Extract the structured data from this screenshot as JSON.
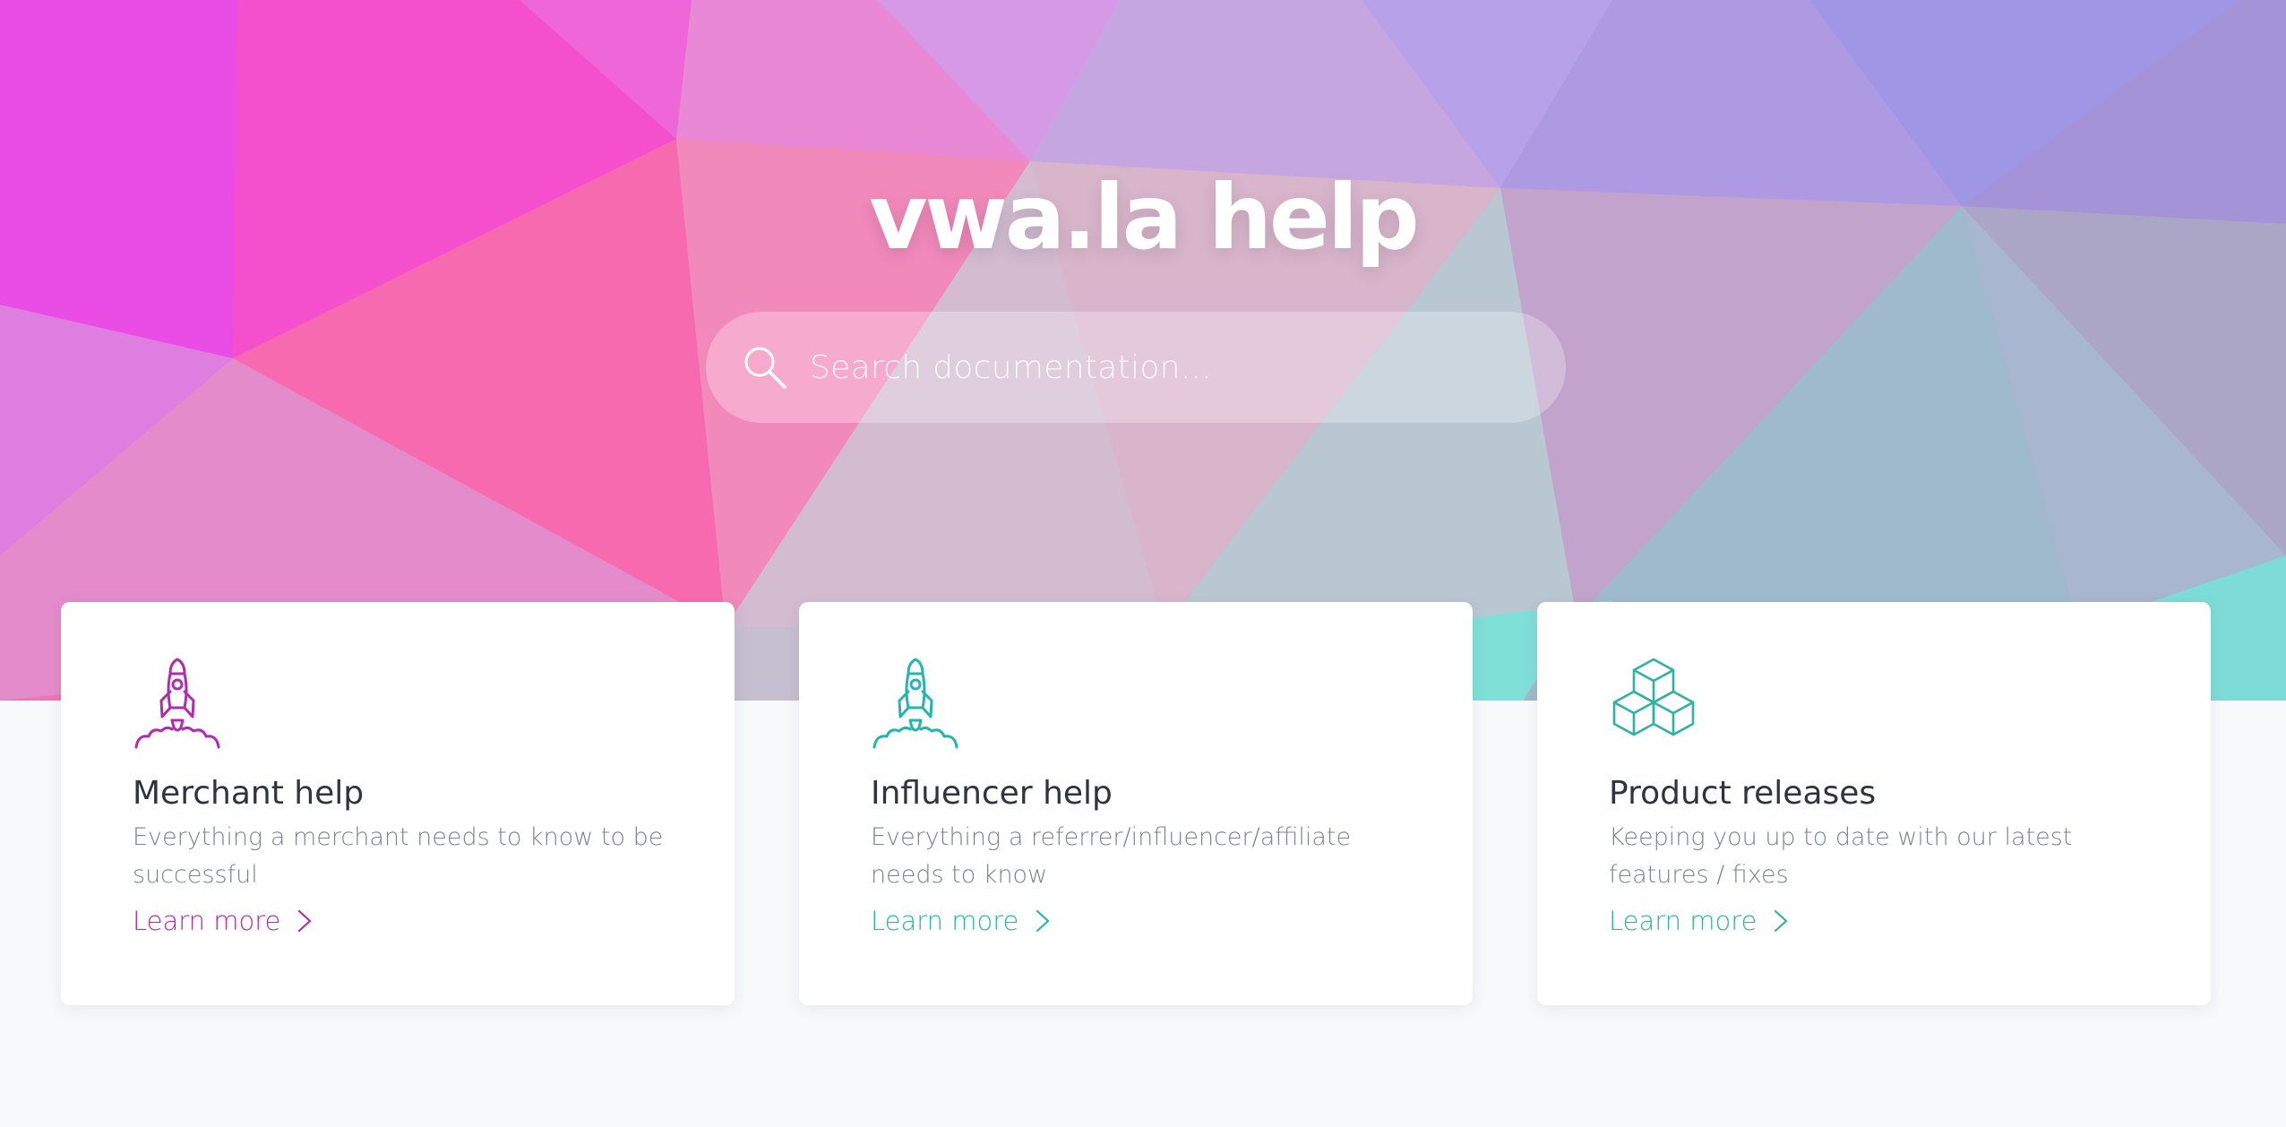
{
  "hero": {
    "title": "vwa.la help",
    "search": {
      "placeholder": "Search documentation..."
    }
  },
  "colors": {
    "merchant_accent": "#b02bb0",
    "influencer_accent": "#25b5b0",
    "releases_accent": "#2fb1a3",
    "title_text": "#2e3440",
    "description_text": "#7a8391",
    "page_background": "#f8f9fb"
  },
  "cards": [
    {
      "icon": "rocket-icon",
      "title": "Merchant help",
      "description": "Everything a merchant needs to know to be successful",
      "link_label": "Learn more",
      "link_icon": "chevron-right-icon"
    },
    {
      "icon": "rocket-icon",
      "title": "Influencer help",
      "description": "Everything a referrer/influencer/affiliate needs to know",
      "link_label": "Learn more",
      "link_icon": "chevron-right-icon"
    },
    {
      "icon": "cubes-icon",
      "title": "Product releases",
      "description": "Keeping you up to date with our latest features / fixes",
      "link_label": "Learn more",
      "link_icon": "chevron-right-icon"
    }
  ]
}
